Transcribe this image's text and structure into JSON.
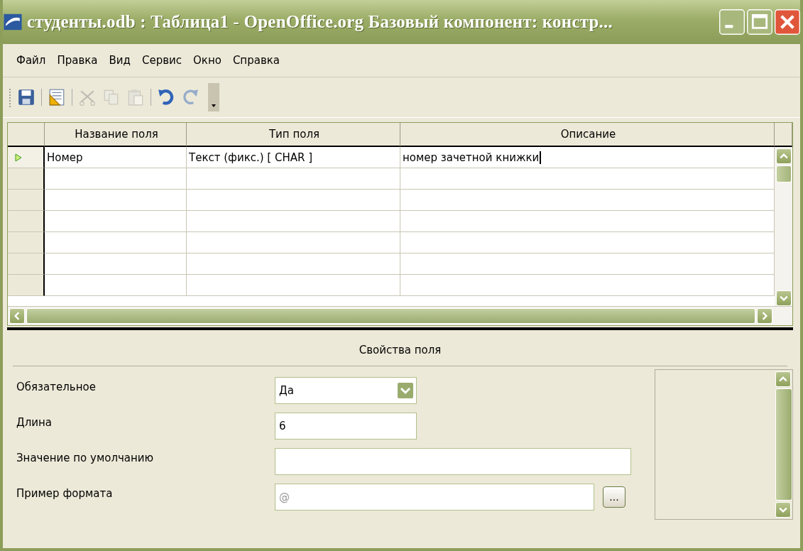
{
  "window": {
    "title": "студенты.odb : Таблица1  - OpenOffice.org Базовый компонент: констр..."
  },
  "menu": [
    {
      "label": "Файл"
    },
    {
      "label": "Правка"
    },
    {
      "label": "Вид"
    },
    {
      "label": "Сервис"
    },
    {
      "label": "Окно"
    },
    {
      "label": "Справка"
    }
  ],
  "toolbar": [
    {
      "kind": "save",
      "disabled": false
    },
    {
      "kind": "sep"
    },
    {
      "kind": "design",
      "disabled": false
    },
    {
      "kind": "sep"
    },
    {
      "kind": "cut",
      "disabled": true
    },
    {
      "kind": "copy",
      "disabled": true
    },
    {
      "kind": "paste",
      "disabled": true
    },
    {
      "kind": "sep"
    },
    {
      "kind": "undo",
      "disabled": false
    },
    {
      "kind": "redo",
      "disabled": true
    },
    {
      "kind": "more"
    }
  ],
  "table": {
    "columns": [
      "Название поля",
      "Тип поля",
      "Описание"
    ],
    "rows": [
      {
        "selected": true,
        "cells": [
          "Номер",
          "Текст (фикс.) [ CHAR ]",
          "номер зачетной книжки"
        ]
      },
      {
        "selected": false,
        "cells": []
      },
      {
        "selected": false,
        "cells": []
      },
      {
        "selected": false,
        "cells": []
      },
      {
        "selected": false,
        "cells": []
      },
      {
        "selected": false,
        "cells": []
      },
      {
        "selected": false,
        "cells": []
      }
    ]
  },
  "properties": {
    "title": "Свойства поля",
    "fields": [
      {
        "kind": "dropdown",
        "label": "Обязательное",
        "value": "Да"
      },
      {
        "kind": "input",
        "label": "Длина",
        "value": "6"
      },
      {
        "kind": "wide",
        "label": "Значение по умолчанию"
      },
      {
        "kind": "format",
        "label": "Пример формата",
        "value": "@",
        "disabled": true,
        "button": "..."
      }
    ]
  }
}
